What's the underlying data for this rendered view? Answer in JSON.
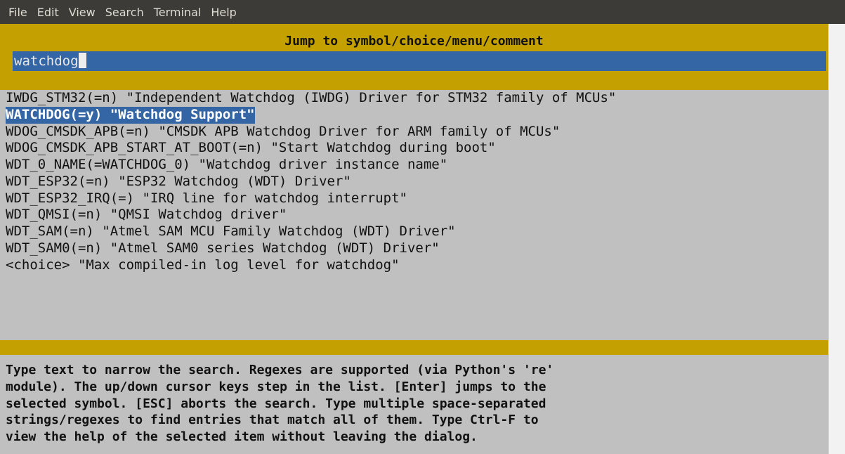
{
  "menubar": {
    "items": [
      "File",
      "Edit",
      "View",
      "Search",
      "Terminal",
      "Help"
    ]
  },
  "dialog": {
    "title": "Jump to symbol/choice/menu/comment",
    "search_value": "watchdog"
  },
  "results": [
    "IWDG_STM32(=n) \"Independent Watchdog (IWDG) Driver for STM32 family of MCUs\"",
    "WATCHDOG(=y) \"Watchdog Support\"",
    "WDOG_CMSDK_APB(=n) \"CMSDK APB Watchdog Driver for ARM family of MCUs\"",
    "WDOG_CMSDK_APB_START_AT_BOOT(=n) \"Start Watchdog during boot\"",
    "WDT_0_NAME(=WATCHDOG_0) \"Watchdog driver instance name\"",
    "WDT_ESP32(=n) \"ESP32 Watchdog (WDT) Driver\"",
    "WDT_ESP32_IRQ(=) \"IRQ line for watchdog interrupt\"",
    "WDT_QMSI(=n) \"QMSI Watchdog driver\"",
    "WDT_SAM(=n) \"Atmel SAM MCU Family Watchdog (WDT) Driver\"",
    "WDT_SAM0(=n) \"Atmel SAM0 series Watchdog (WDT) Driver\"",
    "<choice> \"Max compiled-in log level for watchdog\""
  ],
  "selected_index": 1,
  "help_lines": [
    "Type text to narrow the search. Regexes are supported (via Python's 're'",
    "module). The up/down cursor keys step in the list. [Enter] jumps to the",
    "selected symbol. [ESC] aborts the search. Type multiple space-separated",
    "strings/regexes to find entries that match all of them. Type Ctrl-F to",
    "view the help of the selected item without leaving the dialog."
  ],
  "colors": {
    "menubar_bg": "#3c3b37",
    "dialog_bg": "#c0c0c0",
    "title_bar": "#c4a000",
    "selection": "#3465a4"
  }
}
